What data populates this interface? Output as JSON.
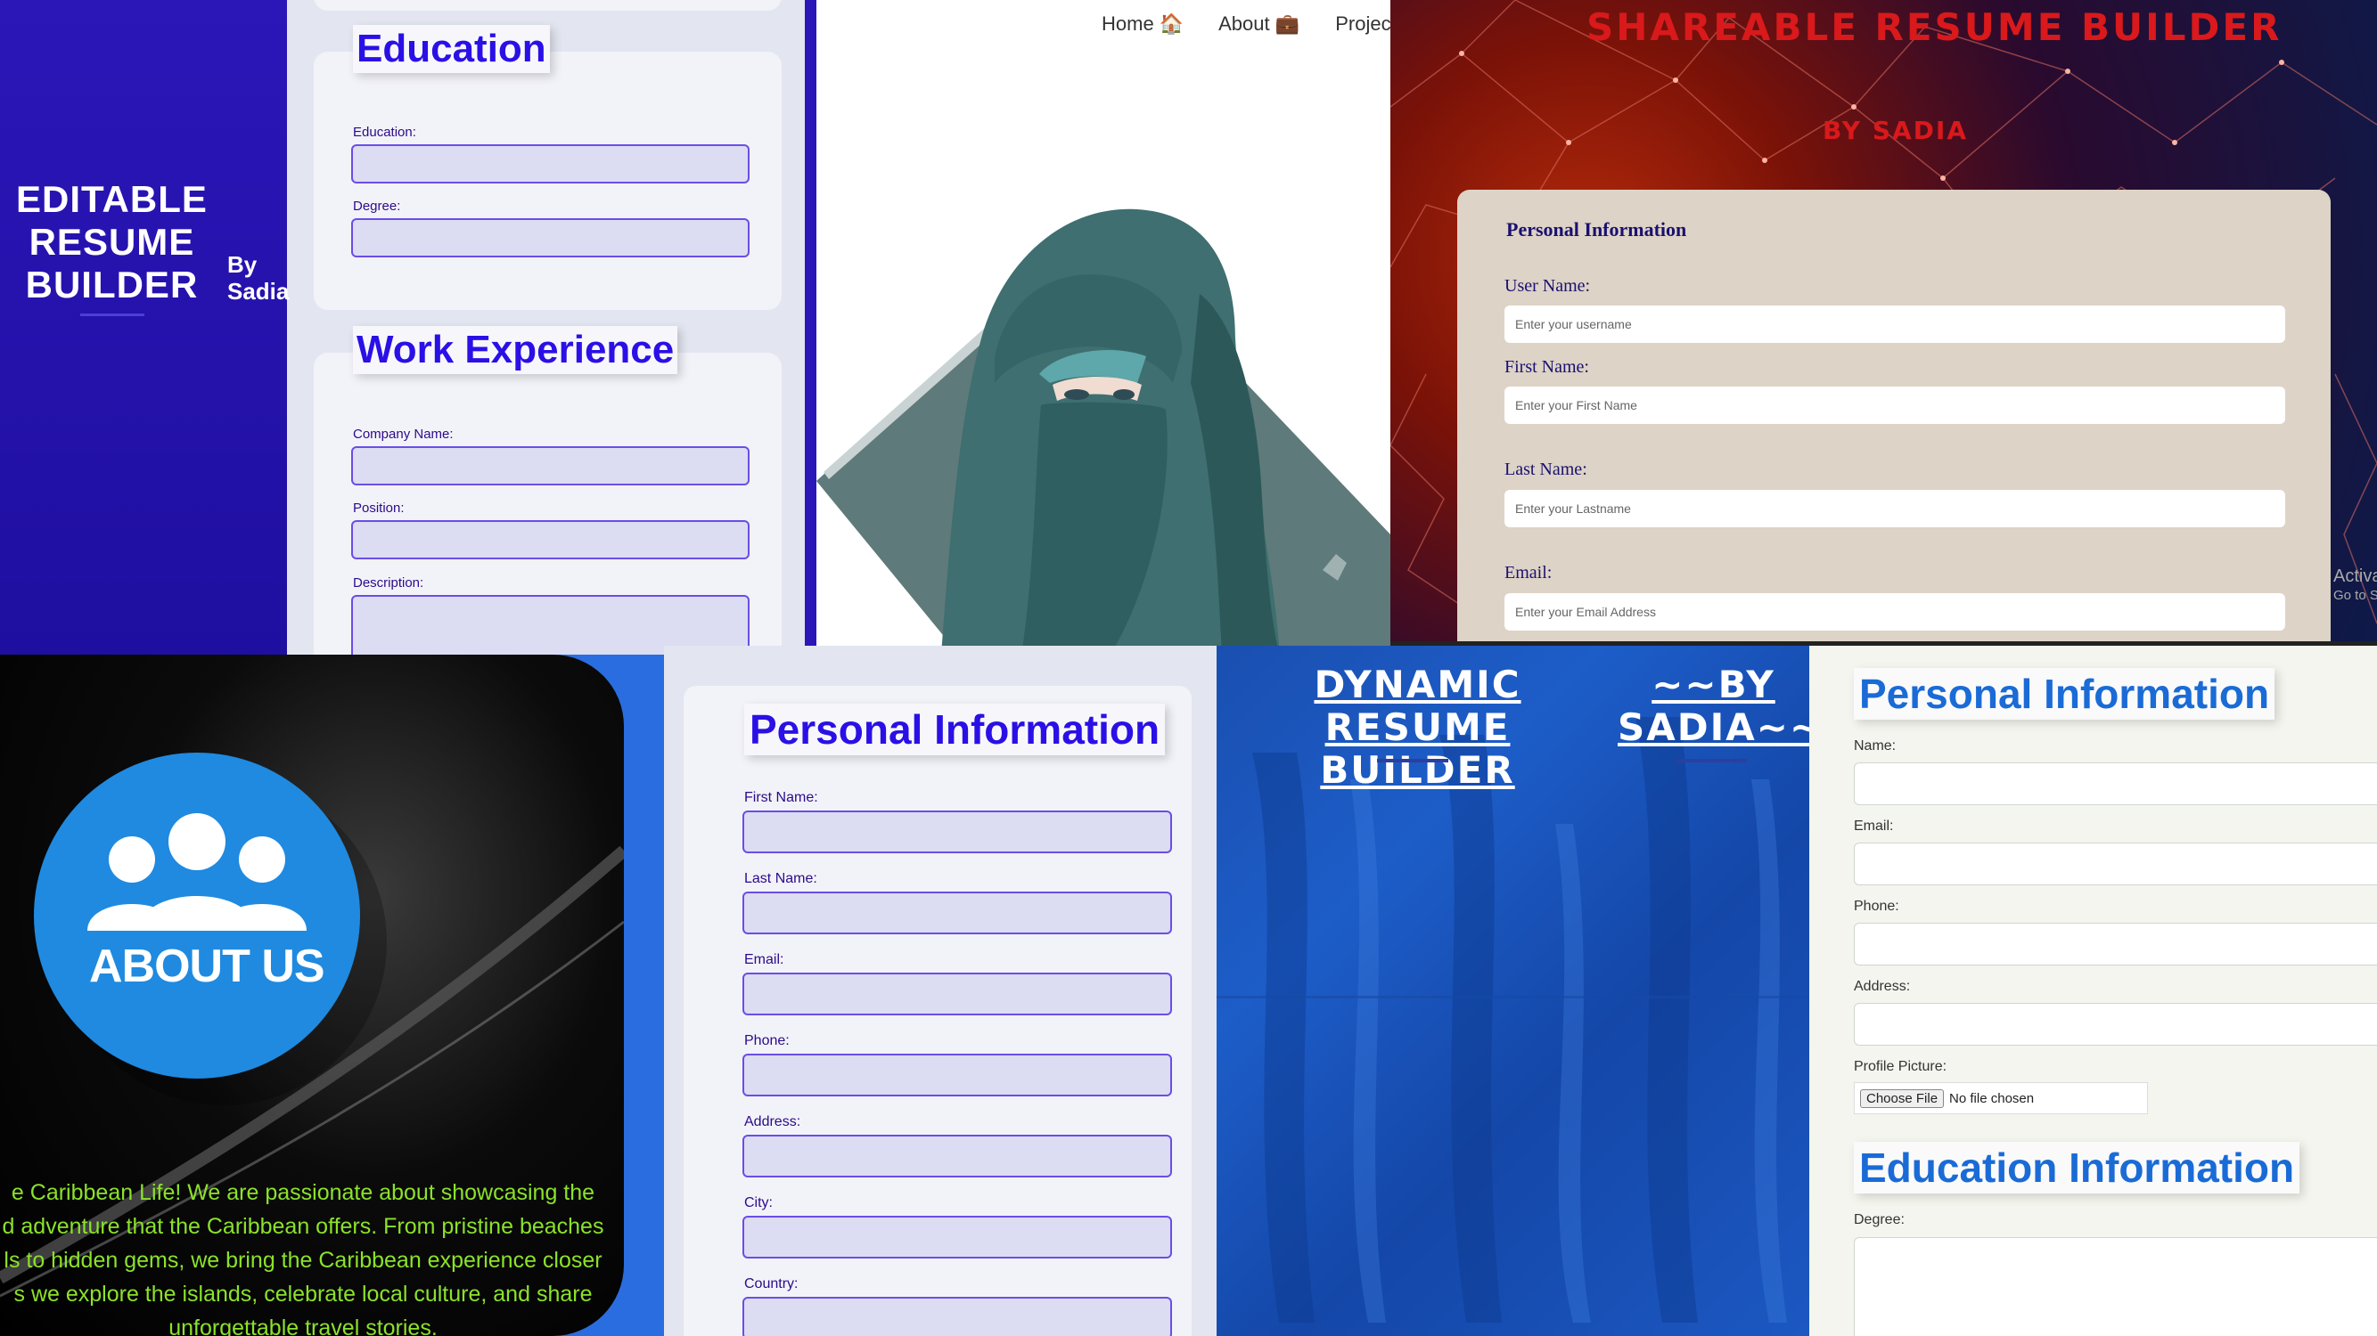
{
  "tile1": {
    "sidebar_title": [
      "EDITABLE",
      "RESUME",
      "BUILDER"
    ],
    "sidebar_by": [
      "By",
      "Sadia"
    ],
    "education": {
      "heading": "Education",
      "labels": [
        "Education:",
        "Degree:"
      ]
    },
    "work": {
      "heading": "Work Experience",
      "labels": [
        "Company Name:",
        "Position:",
        "Description:"
      ]
    }
  },
  "tile2": {
    "nav": [
      "Home 🏠",
      "About 💼",
      "Project"
    ]
  },
  "tile3": {
    "title": "SHAREABLE RESUME BUILDER",
    "by": "BY SADIA",
    "section": "Personal Information",
    "fields": [
      {
        "label": "User Name:",
        "placeholder": "Enter your username"
      },
      {
        "label": "First Name:",
        "placeholder": "Enter your First Name"
      },
      {
        "label": "Last Name:",
        "placeholder": "Enter your Lastname"
      },
      {
        "label": "Email:",
        "placeholder": "Enter your Email Address"
      }
    ],
    "activate": [
      "Activa",
      "Go to S"
    ]
  },
  "tile4": {
    "logo_text": "ABOUT US",
    "paragraph_lines": [
      "e Caribbean Life! We are passionate about showcasing the",
      "d adventure that the Caribbean offers. From pristine beaches",
      "ls to hidden gems, we bring the Caribbean experience closer",
      "s we explore the islands, celebrate local culture, and share",
      "unforgettable travel stories."
    ]
  },
  "tile5": {
    "heading": "Personal Information",
    "labels": [
      "First Name:",
      "Last Name:",
      "Email:",
      "Phone:",
      "Address:",
      "City:",
      "Country:"
    ]
  },
  "tile6": {
    "title_lines": [
      "DYNAMIC RESUME",
      "BUILDER"
    ],
    "by_lines": [
      "~~BY",
      "SADIA~~"
    ]
  },
  "tile7": {
    "heading": "Personal Information",
    "labels": [
      "Name:",
      "Email:",
      "Phone:",
      "Address:",
      "Profile Picture:"
    ],
    "file_button": "Choose File",
    "file_status": "No file chosen",
    "heading2": "Education Information",
    "degree_label": "Degree:"
  }
}
